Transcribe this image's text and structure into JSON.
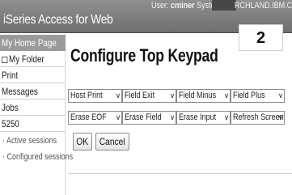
{
  "header": {
    "app_title": "iSeries Access for Web",
    "user_label": "User:",
    "user_name": "cminer",
    "system_label": "System:",
    "system_name": "RCHLAND.IBM.COM"
  },
  "step_number": "2",
  "sidebar": {
    "items": [
      {
        "label": "My Home Page"
      },
      {
        "label": "My Folder"
      },
      {
        "label": "Print"
      },
      {
        "label": "Messages"
      },
      {
        "label": "Jobs"
      },
      {
        "label": "5250"
      },
      {
        "label": "· Active sessions"
      },
      {
        "label": "· Configured sessions"
      }
    ]
  },
  "main": {
    "title": "Configure Top Keypad",
    "keypad_rows": [
      [
        "Host Print",
        "Field Exit",
        "Field Minus",
        "Field Plus"
      ],
      [
        "Erase EOF",
        "Erase Field",
        "Erase Input",
        "Refresh Screen"
      ]
    ],
    "ok_label": "OK",
    "cancel_label": "Cancel"
  }
}
